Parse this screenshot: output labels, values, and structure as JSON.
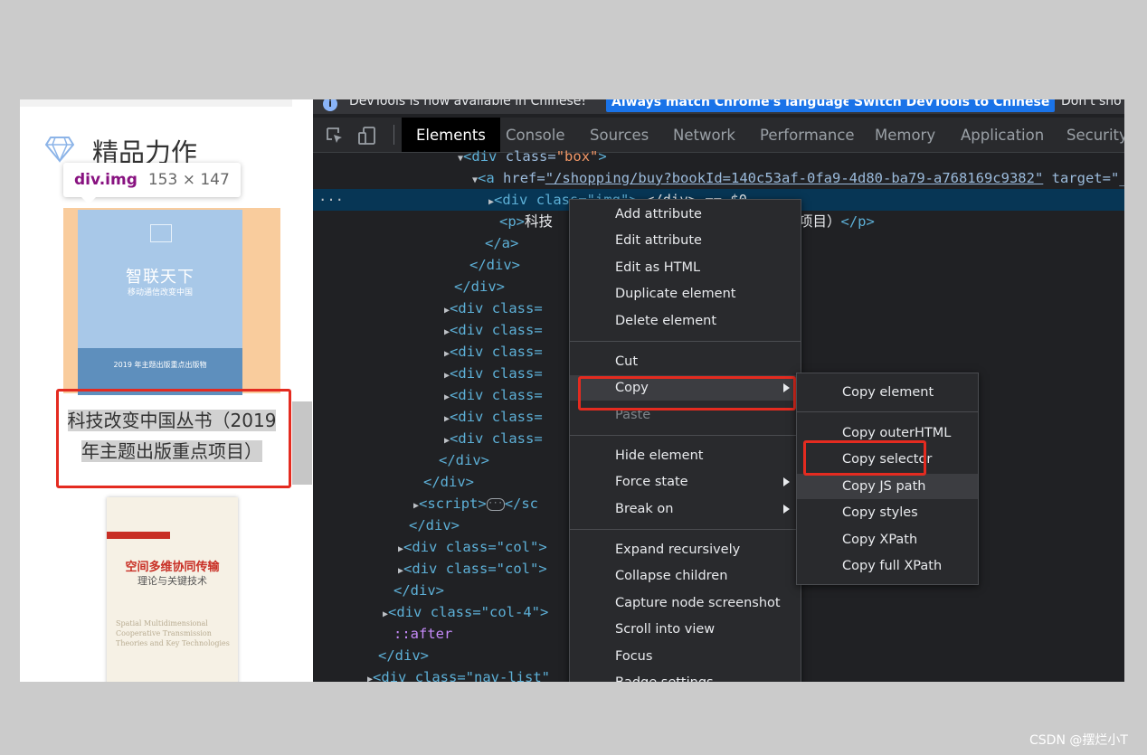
{
  "page": {
    "section_title": "精品力作",
    "tooltip": {
      "tag": "div.img",
      "size": "153 × 147"
    },
    "book1": {
      "title": "智联天下",
      "subtitle": "移动通信改变中国",
      "band_text": "2019 年主题出版重点出版物"
    },
    "caption_line1": "科技改变中国丛书（2019",
    "caption_line2": "年主题出版重点项目）",
    "book2": {
      "title": "空间多维协同传输",
      "subtitle": "理论与关键技术",
      "english": "Spatial Multidimensional Cooperative Transmission Theories and Key Technologies"
    }
  },
  "devtools": {
    "infobar": {
      "message": "DevTools is now available in Chinese!",
      "btn_match": "Always match Chrome's language",
      "btn_switch": "Switch DevTools to Chinese",
      "btn_dont": "Don't sho"
    },
    "tabs": [
      "Elements",
      "Console",
      "Sources",
      "Network",
      "Performance",
      "Memory",
      "Application",
      "Security"
    ],
    "active_tab": "Elements",
    "dom": {
      "l0_tag": "<div",
      "l0_attr": "class=",
      "l0_val": "\"box\"",
      "l0_close": ">",
      "l1_tag": "<a",
      "l1_attr": "href=",
      "l1_link": "\"/shopping/buy?bookId=140c53af-0fa9-4d80-ba79-a768169c9382\"",
      "l1_target": "target=\"_",
      "l2_text": "<div class=\"img\">",
      "l2_tail": "</div> == $0",
      "l3_tag": "<p>",
      "l3_text": "科技",
      "l3_tail": "重点项目）",
      "l3_close": "</p>",
      "close_a": "</a>",
      "close_div": "</div>",
      "div_class": "<div class=",
      "script_open": "<script>",
      "script_close": "</sc",
      "col_line": "<div class=\"col\">",
      "col4_line": "<div class=\"col-4\">",
      "after": "::after",
      "nav_line": "<div class=\"nav-list\""
    },
    "context_menu": [
      "Add attribute",
      "Edit attribute",
      "Edit as HTML",
      "Duplicate element",
      "Delete element",
      "Cut",
      "Copy",
      "Paste",
      "Hide element",
      "Force state",
      "Break on",
      "Expand recursively",
      "Collapse children",
      "Capture node screenshot",
      "Scroll into view",
      "Focus",
      "Badge settings..."
    ],
    "copy_submenu": [
      "Copy element",
      "Copy outerHTML",
      "Copy selector",
      "Copy JS path",
      "Copy styles",
      "Copy XPath",
      "Copy full XPath"
    ]
  },
  "watermark": "CSDN @摆烂小T",
  "colors": {
    "highlight_red": "#e42b20",
    "selected_row": "#073655",
    "devtools_bg": "#202124"
  }
}
